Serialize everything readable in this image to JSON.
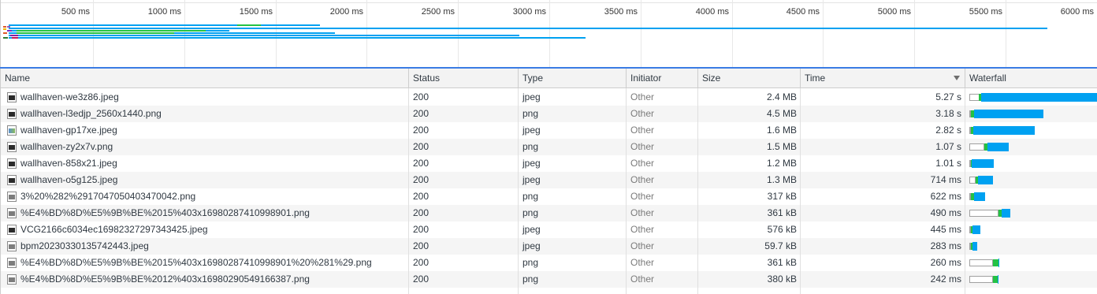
{
  "overview": {
    "ticks": [
      "500 ms",
      "1000 ms",
      "1500 ms",
      "2000 ms",
      "2500 ms",
      "3000 ms",
      "3500 ms",
      "4000 ms",
      "4500 ms",
      "5000 ms",
      "5500 ms",
      "6000 ms"
    ]
  },
  "columns": {
    "name": "Name",
    "status": "Status",
    "type": "Type",
    "initiator": "Initiator",
    "size": "Size",
    "time": "Time",
    "waterfall": "Waterfall"
  },
  "rows": [
    {
      "name": "wallhaven-we3z86.jpeg",
      "status": "200",
      "type": "jpeg",
      "initiator": "Other",
      "size": "2.4 MB",
      "time": "5.27 s",
      "icon": "image-dark-icon"
    },
    {
      "name": "wallhaven-l3edjp_2560x1440.png",
      "status": "200",
      "type": "png",
      "initiator": "Other",
      "size": "4.5 MB",
      "time": "3.18 s",
      "icon": "image-dark-icon"
    },
    {
      "name": "wallhaven-gp17xe.jpeg",
      "status": "200",
      "type": "jpeg",
      "initiator": "Other",
      "size": "1.6 MB",
      "time": "2.82 s",
      "icon": "image-color-icon"
    },
    {
      "name": "wallhaven-zy2x7v.png",
      "status": "200",
      "type": "png",
      "initiator": "Other",
      "size": "1.5 MB",
      "time": "1.07 s",
      "icon": "image-dark-icon"
    },
    {
      "name": "wallhaven-858x21.jpeg",
      "status": "200",
      "type": "jpeg",
      "initiator": "Other",
      "size": "1.2 MB",
      "time": "1.01 s",
      "icon": "image-dark-icon"
    },
    {
      "name": "wallhaven-o5g125.jpeg",
      "status": "200",
      "type": "jpeg",
      "initiator": "Other",
      "size": "1.3 MB",
      "time": "714 ms",
      "icon": "image-dark-icon"
    },
    {
      "name": "3%20%282%2917047050403470042.png",
      "status": "200",
      "type": "png",
      "initiator": "Other",
      "size": "317 kB",
      "time": "622 ms",
      "icon": "image-grey-icon"
    },
    {
      "name": "%E4%BD%8D%E5%9B%BE%2015%403x16980287410998901.png",
      "status": "200",
      "type": "png",
      "initiator": "Other",
      "size": "361 kB",
      "time": "490 ms",
      "icon": "image-grey-icon"
    },
    {
      "name": "VCG2166c6034ec16982327297343425.jpeg",
      "status": "200",
      "type": "jpeg",
      "initiator": "Other",
      "size": "576 kB",
      "time": "445 ms",
      "icon": "image-dark-icon"
    },
    {
      "name": "bpm20230330135742443.jpeg",
      "status": "200",
      "type": "jpeg",
      "initiator": "Other",
      "size": "59.7 kB",
      "time": "283 ms",
      "icon": "image-grey-icon"
    },
    {
      "name": "%E4%BD%8D%E5%9B%BE%2015%403x16980287410998901%20%281%29.png",
      "status": "200",
      "type": "png",
      "initiator": "Other",
      "size": "361 kB",
      "time": "260 ms",
      "icon": "image-grey-icon"
    },
    {
      "name": "%E4%BD%8D%E5%9B%BE%2012%403x16980290549166387.png",
      "status": "200",
      "type": "png",
      "initiator": "Other",
      "size": "380 kB",
      "time": "242 ms",
      "icon": "image-grey-icon"
    }
  ],
  "colors": {
    "ttfb": "#23c244",
    "download": "#00a1f1",
    "selection": "#3b7ce4"
  }
}
